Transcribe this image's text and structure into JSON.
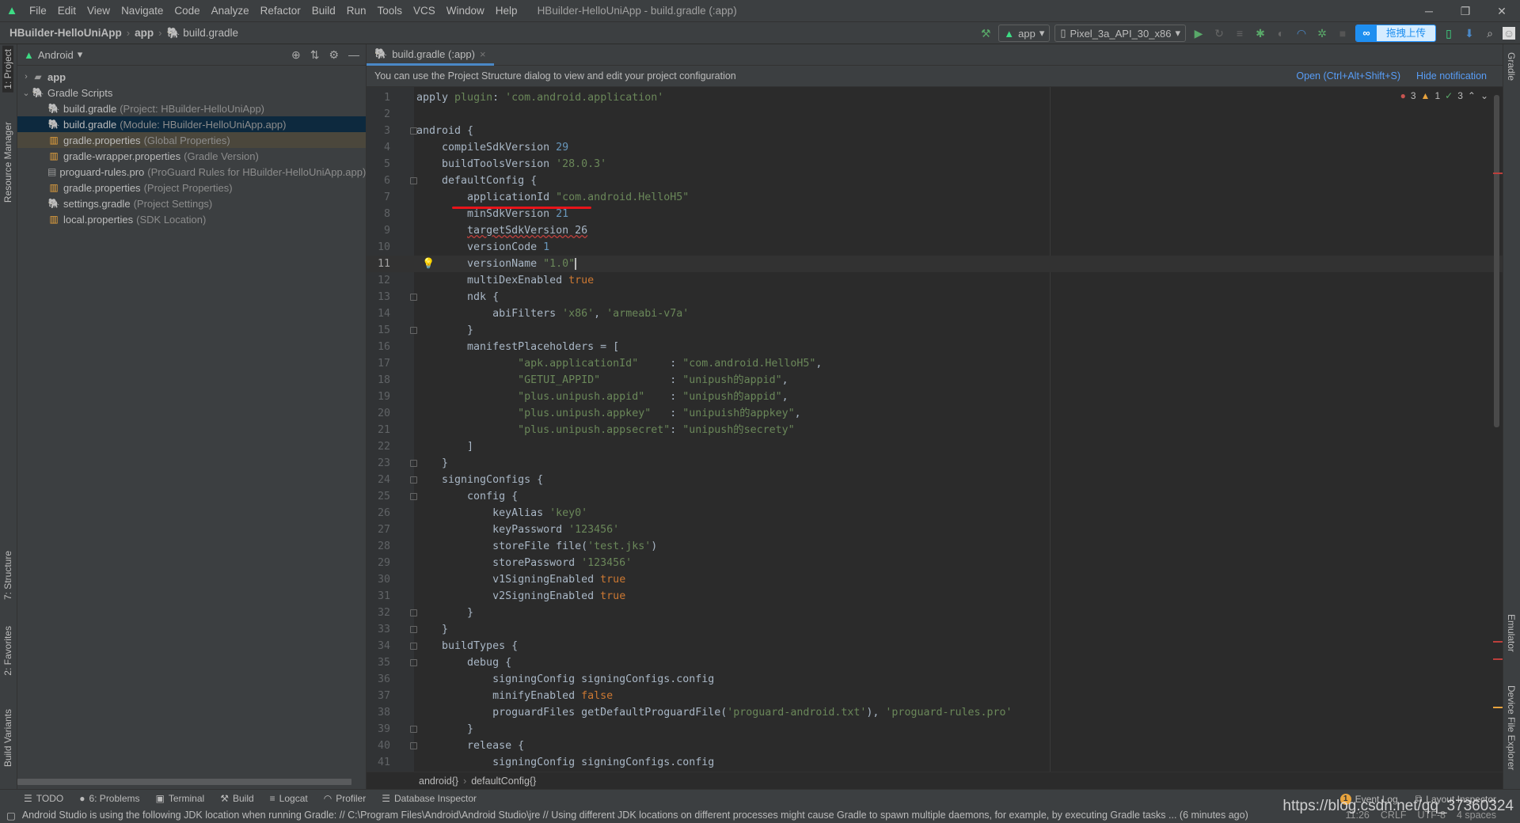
{
  "menubar": {
    "items": [
      "File",
      "Edit",
      "View",
      "Navigate",
      "Code",
      "Analyze",
      "Refactor",
      "Build",
      "Run",
      "Tools",
      "VCS",
      "Window",
      "Help"
    ],
    "title": "HBuilder-HelloUniApp - build.gradle (:app)"
  },
  "window_controls": {
    "minimize": "─",
    "restore": "❐",
    "close": "✕"
  },
  "navbar": {
    "crumbs": [
      "HBuilder-HelloUniApp",
      "app",
      "build.gradle"
    ]
  },
  "toolbar": {
    "run_config": "app",
    "device": "Pixel_3a_API_30_x86",
    "upload_label": "拖拽上传"
  },
  "left_stripe": {
    "project": "1: Project",
    "resource_manager": "Resource Manager",
    "structure": "7: Structure",
    "favorites": "2: Favorites",
    "build_variants": "Build Variants"
  },
  "right_stripe": {
    "gradle": "Gradle",
    "emulator": "Emulator",
    "device_file_explorer": "Device File Explorer"
  },
  "project": {
    "view": "Android",
    "tree": [
      {
        "label": "app",
        "hint": "",
        "icon": "folder-icon",
        "level": 0,
        "expander": "›",
        "bold": true,
        "state": ""
      },
      {
        "label": "Gradle Scripts",
        "hint": "",
        "icon": "gradle-icon",
        "level": 0,
        "expander": "⌄",
        "bold": false,
        "state": ""
      },
      {
        "label": "build.gradle",
        "hint": "(Project: HBuilder-HelloUniApp)",
        "icon": "gradle-icon",
        "level": 1,
        "state": ""
      },
      {
        "label": "build.gradle",
        "hint": "(Module: HBuilder-HelloUniApp.app)",
        "icon": "gradle-icon",
        "level": 1,
        "state": "selected"
      },
      {
        "label": "gradle.properties",
        "hint": "(Global Properties)",
        "icon": "properties-icon",
        "level": 1,
        "state": "highlighted"
      },
      {
        "label": "gradle-wrapper.properties",
        "hint": "(Gradle Version)",
        "icon": "properties-icon",
        "level": 1,
        "state": ""
      },
      {
        "label": "proguard-rules.pro",
        "hint": "(ProGuard Rules for HBuilder-HelloUniApp.app)",
        "icon": "file-icon",
        "level": 1,
        "state": ""
      },
      {
        "label": "gradle.properties",
        "hint": "(Project Properties)",
        "icon": "properties-icon",
        "level": 1,
        "state": ""
      },
      {
        "label": "settings.gradle",
        "hint": "(Project Settings)",
        "icon": "gradle-icon",
        "level": 1,
        "state": ""
      },
      {
        "label": "local.properties",
        "hint": "(SDK Location)",
        "icon": "properties-icon",
        "level": 1,
        "state": ""
      }
    ]
  },
  "editor": {
    "tab": "build.gradle (:app)",
    "notification": "You can use the Project Structure dialog to view and edit your project configuration",
    "notification_open": "Open (Ctrl+Alt+Shift+S)",
    "notification_hide": "Hide notification",
    "inspections": {
      "errors": "3",
      "warnings": "1",
      "ok": "3"
    },
    "current_line": 11,
    "folds": [
      3,
      6,
      13,
      15,
      23,
      24,
      25,
      32,
      33,
      34,
      35,
      39,
      40
    ],
    "lines": [
      [
        [
          "plain",
          "apply "
        ],
        [
          "str",
          "plugin"
        ],
        [
          "plain",
          ": "
        ],
        [
          "str",
          "'com.android.application'"
        ]
      ],
      [],
      [
        [
          "plain",
          "android {"
        ]
      ],
      [
        [
          "plain",
          "    compileSdkVersion "
        ],
        [
          "num",
          "29"
        ]
      ],
      [
        [
          "plain",
          "    buildToolsVersion "
        ],
        [
          "str",
          "'28.0.3'"
        ]
      ],
      [
        [
          "plain",
          "    defaultConfig {"
        ]
      ],
      [
        [
          "plain",
          "        applicationId "
        ],
        [
          "str",
          "\"com.android.HelloH5\""
        ]
      ],
      [
        [
          "plain",
          "        minSdkVersion "
        ],
        [
          "num",
          "21"
        ]
      ],
      [
        [
          "plain",
          "        "
        ],
        [
          "squig",
          "targetSdkVersion 26"
        ]
      ],
      [
        [
          "plain",
          "        versionCode "
        ],
        [
          "num",
          "1"
        ]
      ],
      [
        [
          "plain",
          "        versionName "
        ],
        [
          "str",
          "\"1.0\""
        ],
        [
          "cur",
          ""
        ]
      ],
      [
        [
          "plain",
          "        multiDexEnabled "
        ],
        [
          "kw",
          "true"
        ]
      ],
      [
        [
          "plain",
          "        ndk {"
        ]
      ],
      [
        [
          "plain",
          "            abiFilters "
        ],
        [
          "str",
          "'x86'"
        ],
        [
          "plain",
          ", "
        ],
        [
          "str",
          "'armeabi-v7a'"
        ]
      ],
      [
        [
          "plain",
          "        }"
        ]
      ],
      [
        [
          "plain",
          "        manifestPlaceholders = ["
        ]
      ],
      [
        [
          "plain",
          "                "
        ],
        [
          "str",
          "\"apk.applicationId\""
        ],
        [
          "plain",
          "     : "
        ],
        [
          "str",
          "\"com.android.HelloH5\""
        ],
        [
          "plain",
          ","
        ]
      ],
      [
        [
          "plain",
          "                "
        ],
        [
          "str",
          "\"GETUI_APPID\""
        ],
        [
          "plain",
          "           : "
        ],
        [
          "str",
          "\"unipush的appid\""
        ],
        [
          "plain",
          ","
        ]
      ],
      [
        [
          "plain",
          "                "
        ],
        [
          "str",
          "\"plus.unipush.appid\""
        ],
        [
          "plain",
          "    : "
        ],
        [
          "str",
          "\"unipush的appid\""
        ],
        [
          "plain",
          ","
        ]
      ],
      [
        [
          "plain",
          "                "
        ],
        [
          "str",
          "\"plus.unipush.appkey\""
        ],
        [
          "plain",
          "   : "
        ],
        [
          "str",
          "\"unipuish的appkey\""
        ],
        [
          "plain",
          ","
        ]
      ],
      [
        [
          "plain",
          "                "
        ],
        [
          "str",
          "\"plus.unipush.appsecret\""
        ],
        [
          "plain",
          ": "
        ],
        [
          "str",
          "\"unipush的secrety\""
        ]
      ],
      [
        [
          "plain",
          "        ]"
        ]
      ],
      [
        [
          "plain",
          "    }"
        ]
      ],
      [
        [
          "plain",
          "    signingConfigs {"
        ]
      ],
      [
        [
          "plain",
          "        config {"
        ]
      ],
      [
        [
          "plain",
          "            keyAlias "
        ],
        [
          "str",
          "'key0'"
        ]
      ],
      [
        [
          "plain",
          "            keyPassword "
        ],
        [
          "str",
          "'123456'"
        ]
      ],
      [
        [
          "plain",
          "            storeFile file("
        ],
        [
          "str",
          "'test.jks'"
        ],
        [
          "plain",
          ")"
        ]
      ],
      [
        [
          "plain",
          "            storePassword "
        ],
        [
          "str",
          "'123456'"
        ]
      ],
      [
        [
          "plain",
          "            v1SigningEnabled "
        ],
        [
          "kw",
          "true"
        ]
      ],
      [
        [
          "plain",
          "            v2SigningEnabled "
        ],
        [
          "kw",
          "true"
        ]
      ],
      [
        [
          "plain",
          "        }"
        ]
      ],
      [
        [
          "plain",
          "    }"
        ]
      ],
      [
        [
          "plain",
          "    buildTypes {"
        ]
      ],
      [
        [
          "plain",
          "        debug {"
        ]
      ],
      [
        [
          "plain",
          "            signingConfig signingConfigs.config"
        ]
      ],
      [
        [
          "plain",
          "            minifyEnabled "
        ],
        [
          "kw",
          "false"
        ]
      ],
      [
        [
          "plain",
          "            proguardFiles getDefaultProguardFile("
        ],
        [
          "str",
          "'proguard-android.txt'"
        ],
        [
          "plain",
          "), "
        ],
        [
          "str",
          "'proguard-rules.pro'"
        ]
      ],
      [
        [
          "plain",
          "        }"
        ]
      ],
      [
        [
          "plain",
          "        release {"
        ]
      ],
      [
        [
          "plain",
          "            signingConfig signingConfigs.config"
        ]
      ]
    ],
    "breadcrumbs": [
      "android{}",
      "defaultConfig{}"
    ]
  },
  "toolwindows": {
    "left": [
      "TODO",
      "6: Problems",
      "Terminal",
      "Build",
      "Logcat",
      "Profiler",
      "Database Inspector"
    ],
    "event_log": "Event Log",
    "event_count": "1",
    "layout_inspector": "Layout Inspector"
  },
  "status": {
    "message": "Android Studio is using the following JDK location when running Gradle: // C:\\Program Files\\Android\\Android Studio\\jre // Using different JDK locations on different processes might cause Gradle to spawn multiple daemons, for example, by executing Gradle tasks ... (6 minutes ago)",
    "position": "11:26",
    "line_sep": "CRLF",
    "encoding": "UTF-8",
    "indent": "4 spaces"
  },
  "watermark": "https://blog.csdn.net/qq_37360324",
  "colors": {
    "accent": "#4a88c7",
    "string": "#6a8759",
    "number": "#6897bb",
    "keyword": "#cc7832",
    "plain": "#a9b7c6",
    "upload": "#1e8ff0"
  }
}
